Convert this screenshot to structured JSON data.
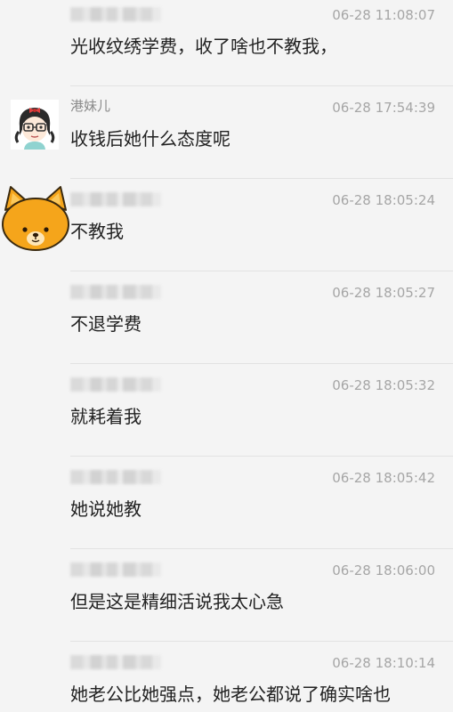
{
  "messages": [
    {
      "author": "",
      "author_blurred": true,
      "time": "06-28 11:08:07",
      "text": "光收纹绣学费，收了啥也不教我，",
      "avatar": ""
    },
    {
      "author": "港妹儿",
      "author_blurred": false,
      "time": "06-28 17:54:39",
      "text": "收钱后她什么态度呢",
      "avatar": "girl-glasses-avatar"
    },
    {
      "author": "",
      "author_blurred": true,
      "time": "06-28 18:05:24",
      "text": "不教我",
      "avatar": "orange-bear-avatar"
    },
    {
      "author": "",
      "author_blurred": true,
      "time": "06-28 18:05:27",
      "text": "不退学费",
      "avatar": ""
    },
    {
      "author": "",
      "author_blurred": true,
      "time": "06-28 18:05:32",
      "text": "就耗着我",
      "avatar": ""
    },
    {
      "author": "",
      "author_blurred": true,
      "time": "06-28 18:05:42",
      "text": "她说她教",
      "avatar": ""
    },
    {
      "author": "",
      "author_blurred": true,
      "time": "06-28 18:06:00",
      "text": "但是这是精细活说我太心急",
      "avatar": ""
    },
    {
      "author": "",
      "author_blurred": true,
      "time": "06-28 18:10:14",
      "text": "她老公比她强点，她老公都说了确实啥也",
      "avatar": ""
    }
  ]
}
